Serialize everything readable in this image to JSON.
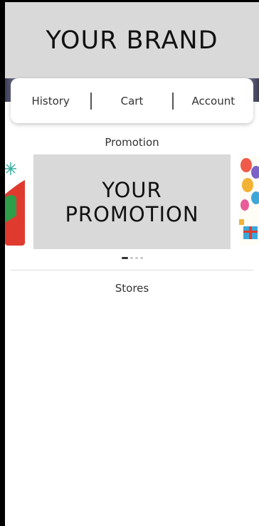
{
  "header": {
    "brand": "YOUR BRAND"
  },
  "nav": {
    "items": [
      {
        "label": "History"
      },
      {
        "label": "Cart"
      },
      {
        "label": "Account"
      }
    ]
  },
  "promotion": {
    "section_title": "Promotion",
    "card_line1": "YOUR",
    "card_line2": "PROMOTION",
    "slide_count": 4,
    "active_slide": 1
  },
  "stores": {
    "section_title": "Stores"
  },
  "colors": {
    "header_bg": "#d9d9d9",
    "promo_bg": "#d9d9d9",
    "text": "#333333"
  }
}
